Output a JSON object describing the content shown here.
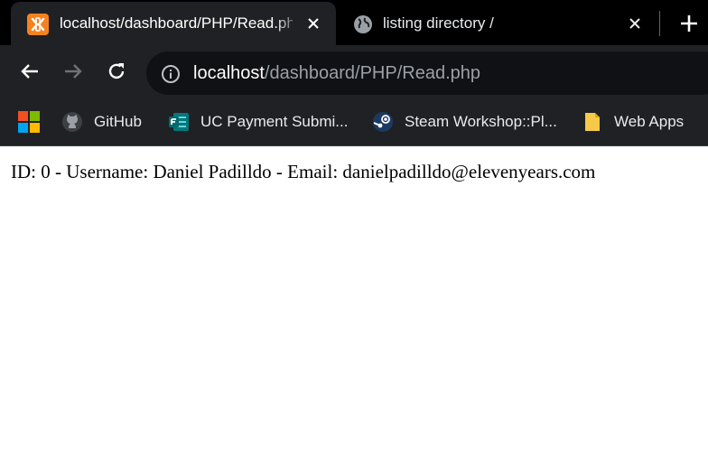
{
  "browser": {
    "tabs": [
      {
        "title": "localhost/dashboard/PHP/Read.php",
        "favicon": "xampp-icon",
        "active": true
      },
      {
        "title": "listing directory /",
        "favicon": "globe-icon",
        "active": false
      }
    ],
    "address_bar": {
      "host": "localhost",
      "path": "/dashboard/PHP/Read.php"
    },
    "bookmarks": [
      {
        "label": "",
        "icon": "microsoft-apps-icon"
      },
      {
        "label": "GitHub",
        "icon": "github-icon"
      },
      {
        "label": "UC Payment Submi...",
        "icon": "forms-icon"
      },
      {
        "label": "Steam Workshop::Pl...",
        "icon": "steam-icon"
      },
      {
        "label": "Web Apps",
        "icon": "folder-icon"
      }
    ]
  },
  "page": {
    "record_text": "ID: 0 - Username: Daniel Padilldo - Email: danielpadilldo@elevenyears.com"
  },
  "colors": {
    "tabstrip": "#000000",
    "toolbar": "#202124",
    "omnibox": "#101114",
    "xampp_orange": "#f58220"
  }
}
